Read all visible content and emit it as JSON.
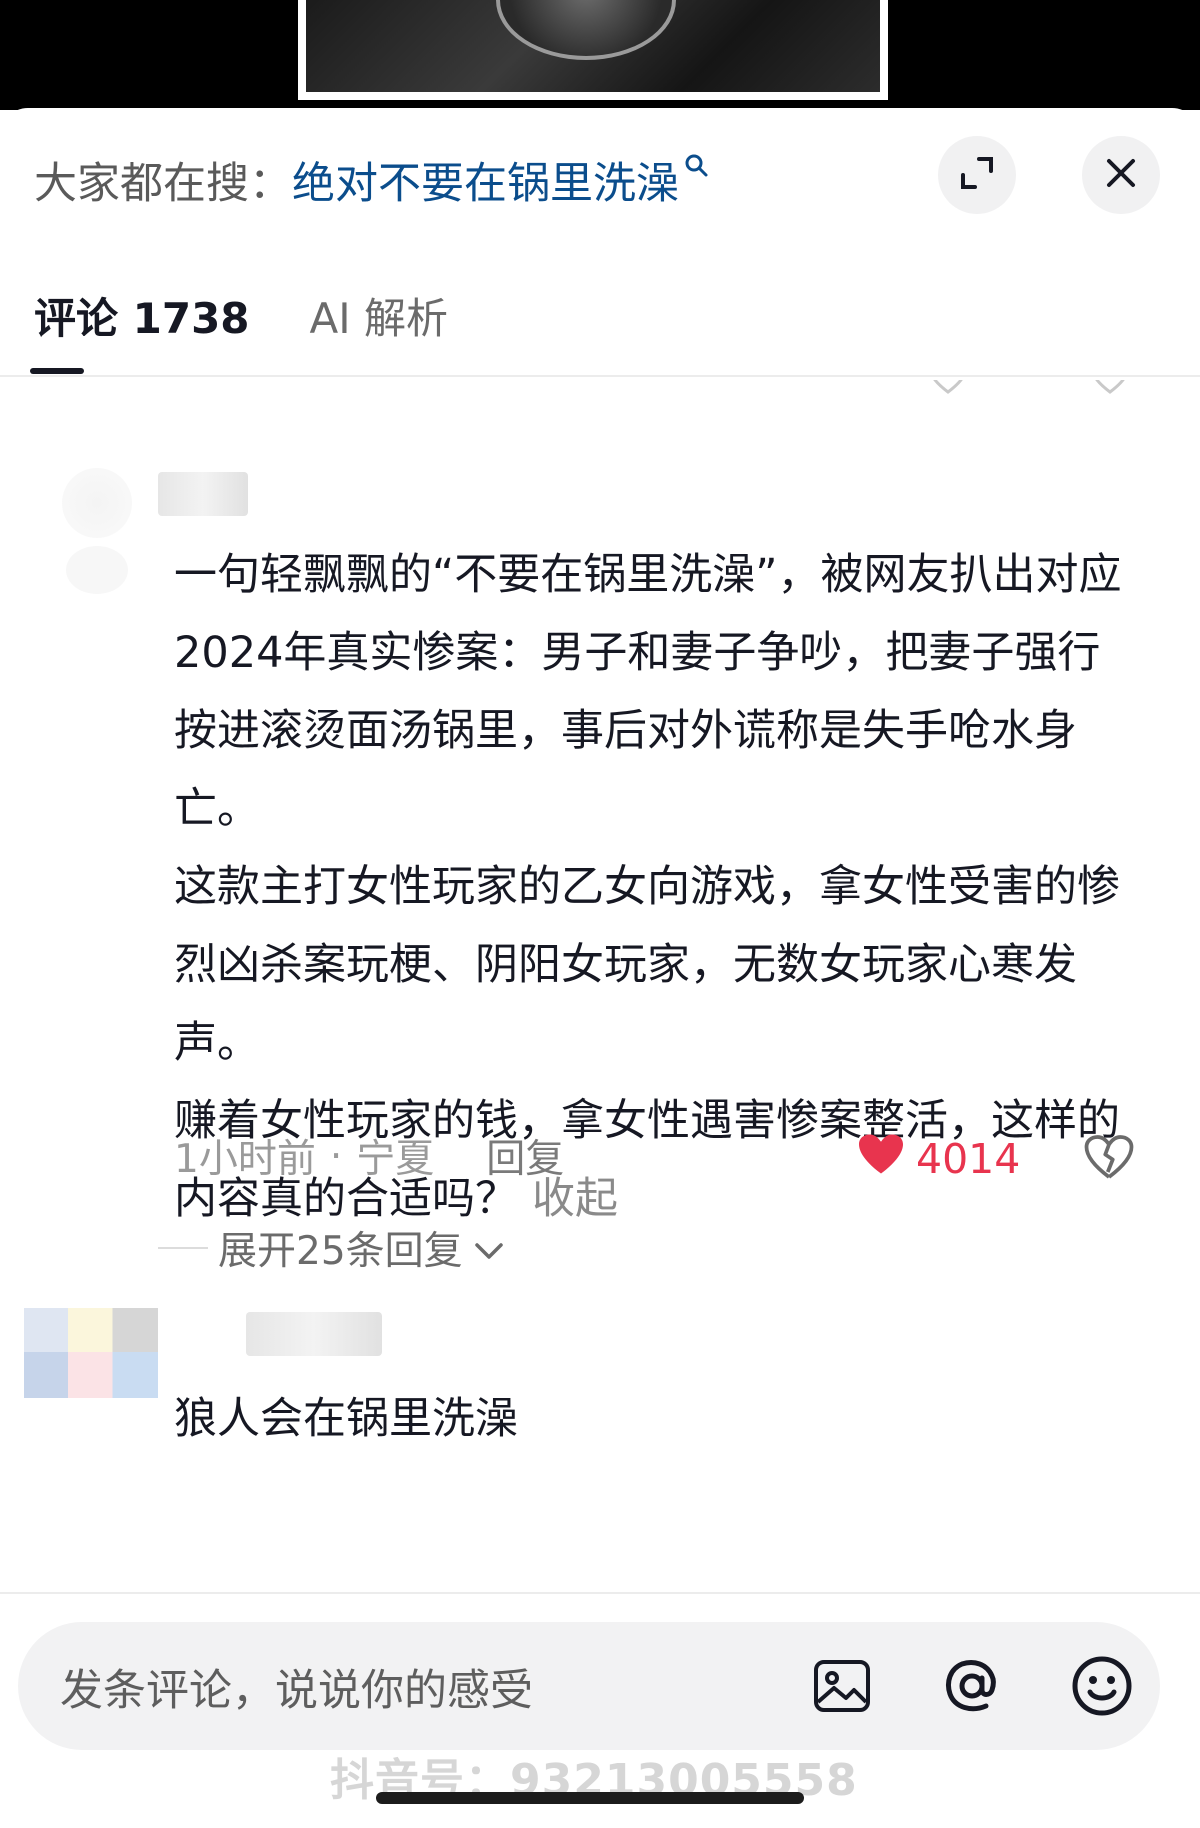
{
  "header": {
    "search_prefix": "大家都在搜：",
    "search_term": "绝对不要在锅里洗澡",
    "search_icon": "search-icon",
    "expand_icon": "expand-icon",
    "close_icon": "close-icon"
  },
  "tabs": [
    {
      "label": "评论 1738",
      "active": true
    },
    {
      "label": "AI 解析",
      "active": false
    }
  ],
  "comment_main": {
    "text": "一句轻飘飘的“不要在锅里洗澡”，被网友扒出对应2024年真实惨案：男子和妻子争吵，把妻子强行按进滚烫面汤锅里，事后对外谎称是失手呛水身亡。\n这款主打女性玩家的乙女向游戏，拿女性受害的惨烈凶杀案玩梗、阴阳女玩家，无数女玩家心寒发声。\n赚着女性玩家的钱，拿女性遇害惨案整活，这样的内容真的合适吗？",
    "collapse_label": "收起",
    "time": "1小时前",
    "location": "宁夏",
    "reply_label": "回复",
    "like_count": "4014",
    "like_color": "#e8344e",
    "expand_replies_label": "展开25条回复"
  },
  "comment_second": {
    "text": "狼人会在锅里洗澡"
  },
  "bottom": {
    "input_placeholder": "发条评论，说说你的感受",
    "image_icon": "image-icon",
    "at_icon": "at-icon",
    "emoji_icon": "emoji-icon"
  },
  "watermark": "抖音号：93213005558"
}
